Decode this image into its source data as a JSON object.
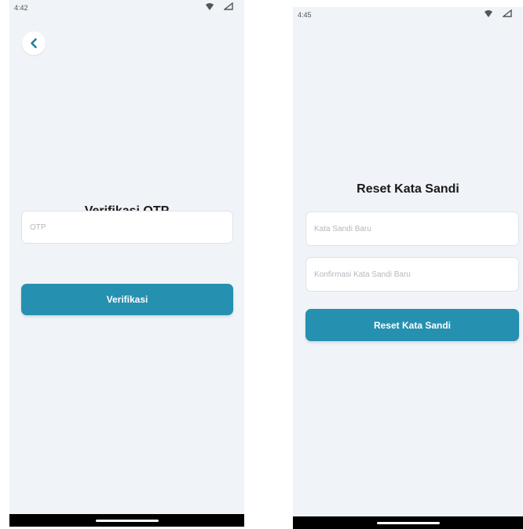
{
  "otp_screen": {
    "status_time": "4:42",
    "title": "Verifikasi OTP",
    "otp_placeholder": "OTP",
    "verify_label": "Verifikasi"
  },
  "reset_screen": {
    "status_time": "4:45",
    "title": "Reset Kata Sandi",
    "new_password_placeholder": "Kata Sandi Baru",
    "confirm_password_placeholder": "Konfirmasi Kata Sandi Baru",
    "reset_label": "Reset Kata Sandi"
  },
  "icons": {
    "back": "chevron-left-icon",
    "wifi": "wifi-icon",
    "signal": "signal-icon"
  },
  "colors": {
    "accent": "#2690b0",
    "background": "#f0f3f7",
    "title_text": "#1a1a1a"
  }
}
